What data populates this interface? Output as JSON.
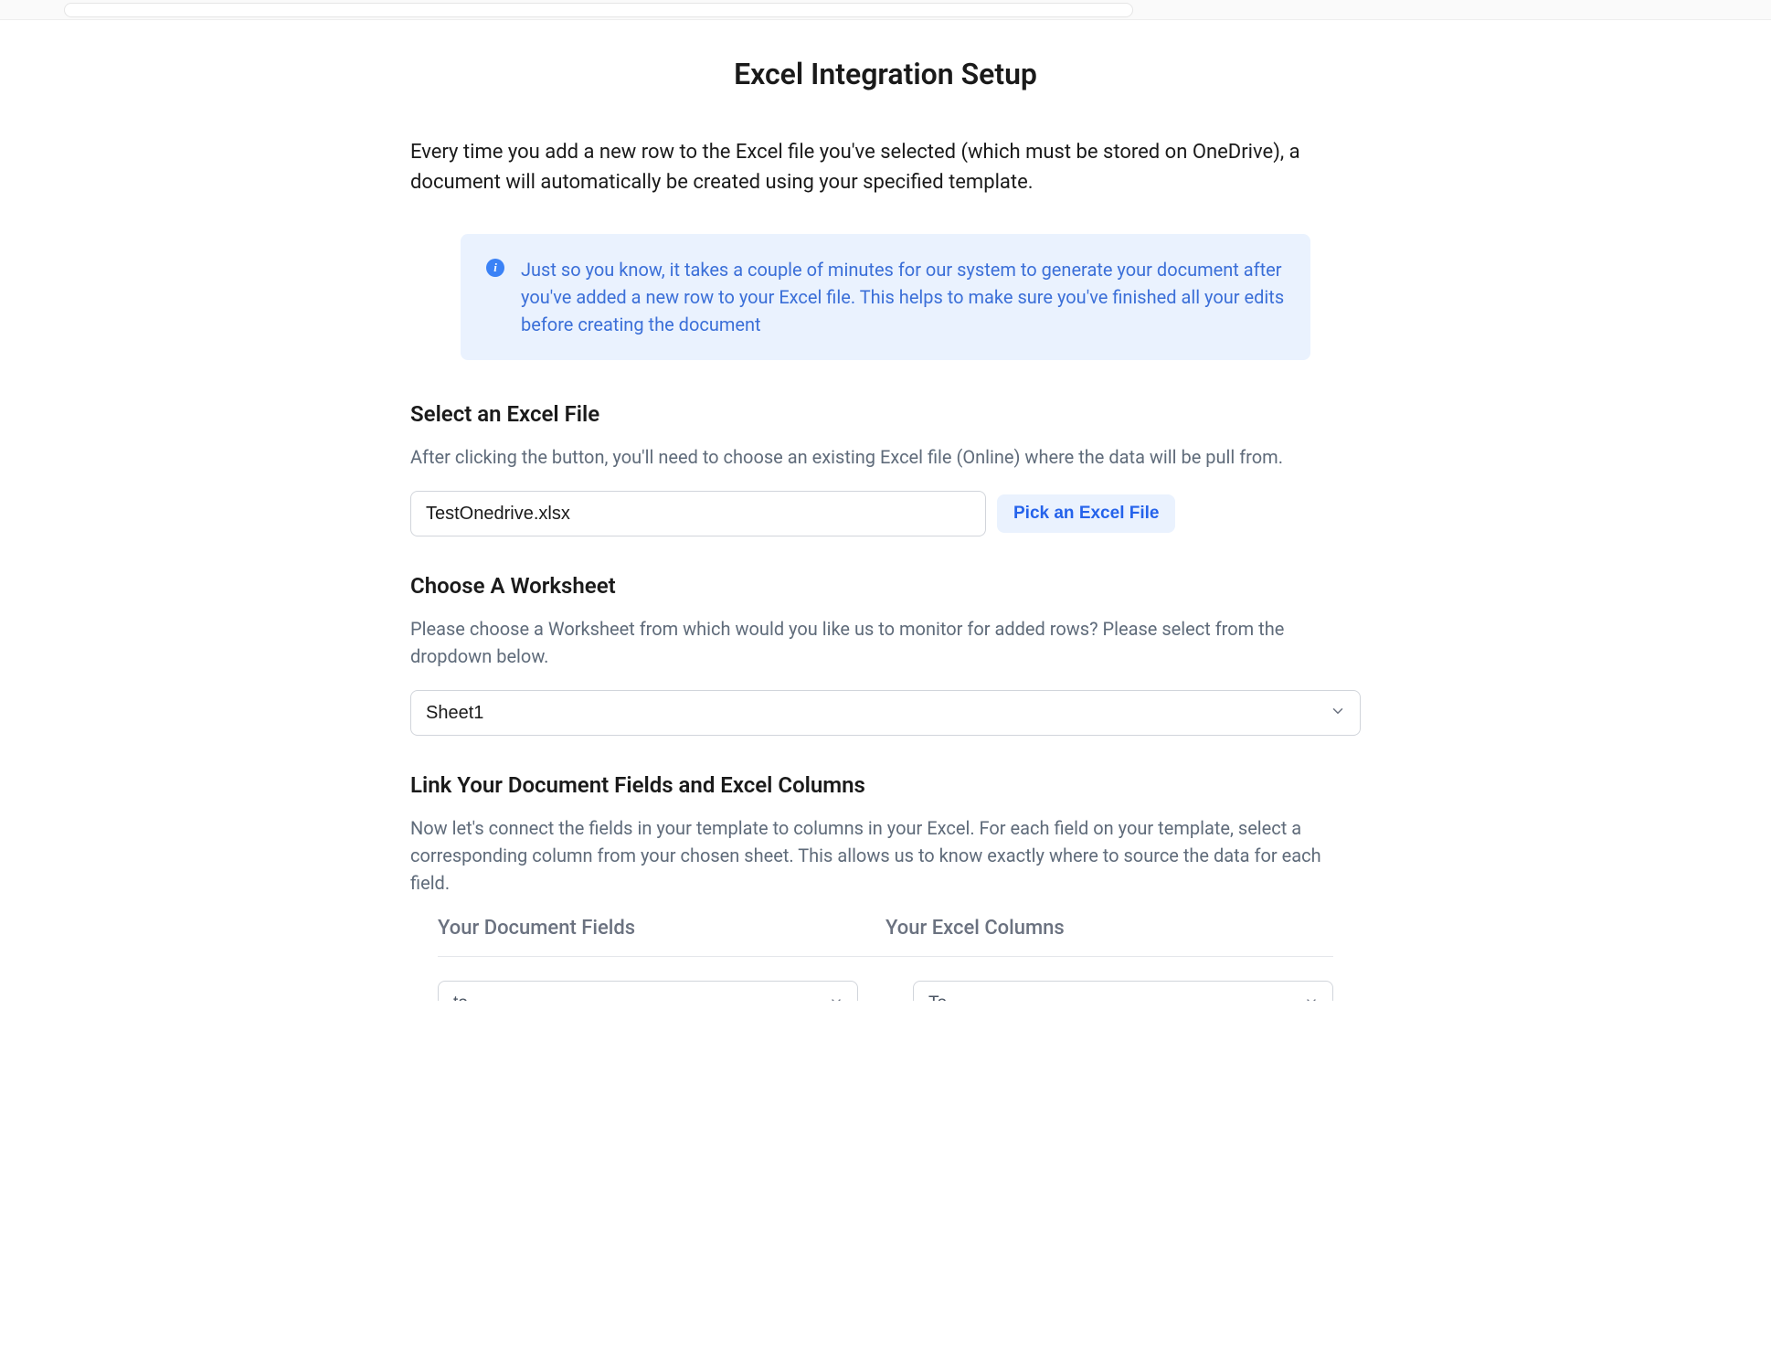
{
  "page": {
    "title": "Excel Integration Setup",
    "intro": "Every time you add a new row to the Excel file you've selected (which must be stored on OneDrive), a document will automatically be created using your specified template."
  },
  "info_box": {
    "text": "Just so you know, it takes a couple of minutes for our system to generate your document after you've added a new row to your Excel file. This helps to make sure you've finished all your edits before creating the document"
  },
  "select_file": {
    "title": "Select an Excel File",
    "desc": "After clicking the button, you'll need to choose an existing Excel file (Online) where the data will be pull from.",
    "value": "TestOnedrive.xlsx",
    "button_label": "Pick an Excel File"
  },
  "worksheet": {
    "title": "Choose A Worksheet",
    "desc": "Please choose a Worksheet from which would you like us to monitor for added rows? Please select from the dropdown below.",
    "value": "Sheet1"
  },
  "link_fields": {
    "title": "Link Your Document Fields and Excel Columns",
    "desc": "Now let's connect the fields in your template to columns in your Excel. For each field on your template, select a corresponding column from your chosen sheet. This allows us to know exactly where to source the data for each field.",
    "col1_header": "Your Document Fields",
    "col2_header": "Your Excel Columns",
    "row1_field": "to",
    "row1_column": "To"
  },
  "icons": {
    "info_glyph": "i"
  }
}
